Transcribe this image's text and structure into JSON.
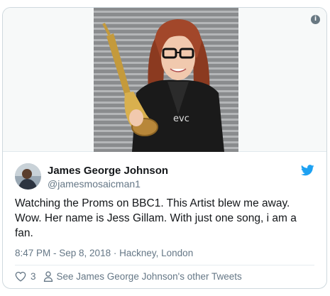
{
  "tweet": {
    "author_name": "James George Johnson",
    "author_handle": "@jamesmosaicman1",
    "text": "Watching the Proms on BBC1.  This Artist blew me away.  Wow.  Her name is Jess Gillam.  With just one song, i am a fan.",
    "time": "8:47 PM - Sep 8, 2018",
    "location": "Hackney, London",
    "like_count": "3",
    "other_tweets_link": "See James George Johnson's other Tweets"
  },
  "icons": {
    "info": "info-icon",
    "brand": "twitter-bird-icon",
    "like": "heart-icon",
    "profile": "person-icon"
  },
  "colors": {
    "brand_blue": "#1da1f2",
    "secondary_text": "#657786",
    "primary_text": "#14171a",
    "border": "#cfd9de"
  }
}
